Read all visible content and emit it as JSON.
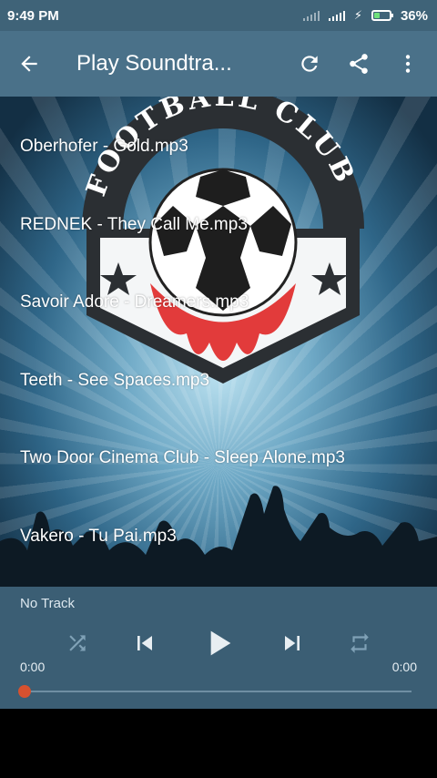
{
  "status_bar": {
    "time": "9:49 PM",
    "battery": "36%",
    "battery_level": 0.36
  },
  "app_bar": {
    "title": "Play Soundtra...",
    "icons": [
      "back-arrow-icon",
      "refresh-icon",
      "share-icon",
      "more-vert-icon"
    ]
  },
  "tracks": [
    "Oberhofer - Gold.mp3",
    "REDNEK - They Call Me.mp3",
    "Savoir Adore - Dreamers.mp3",
    "Teeth - See Spaces.mp3",
    "Two Door Cinema Club - Sleep Alone.mp3",
    "Vakero - Tu Pai.mp3"
  ],
  "logo_text": "FOOTBALL CLUB",
  "player": {
    "now_playing": "No Track",
    "time_start": "0:00",
    "time_end": "0:00",
    "progress": 0,
    "accent": "#d6512f",
    "controls": [
      "shuffle-icon",
      "previous-icon",
      "play-icon",
      "next-icon",
      "repeat-icon"
    ]
  }
}
